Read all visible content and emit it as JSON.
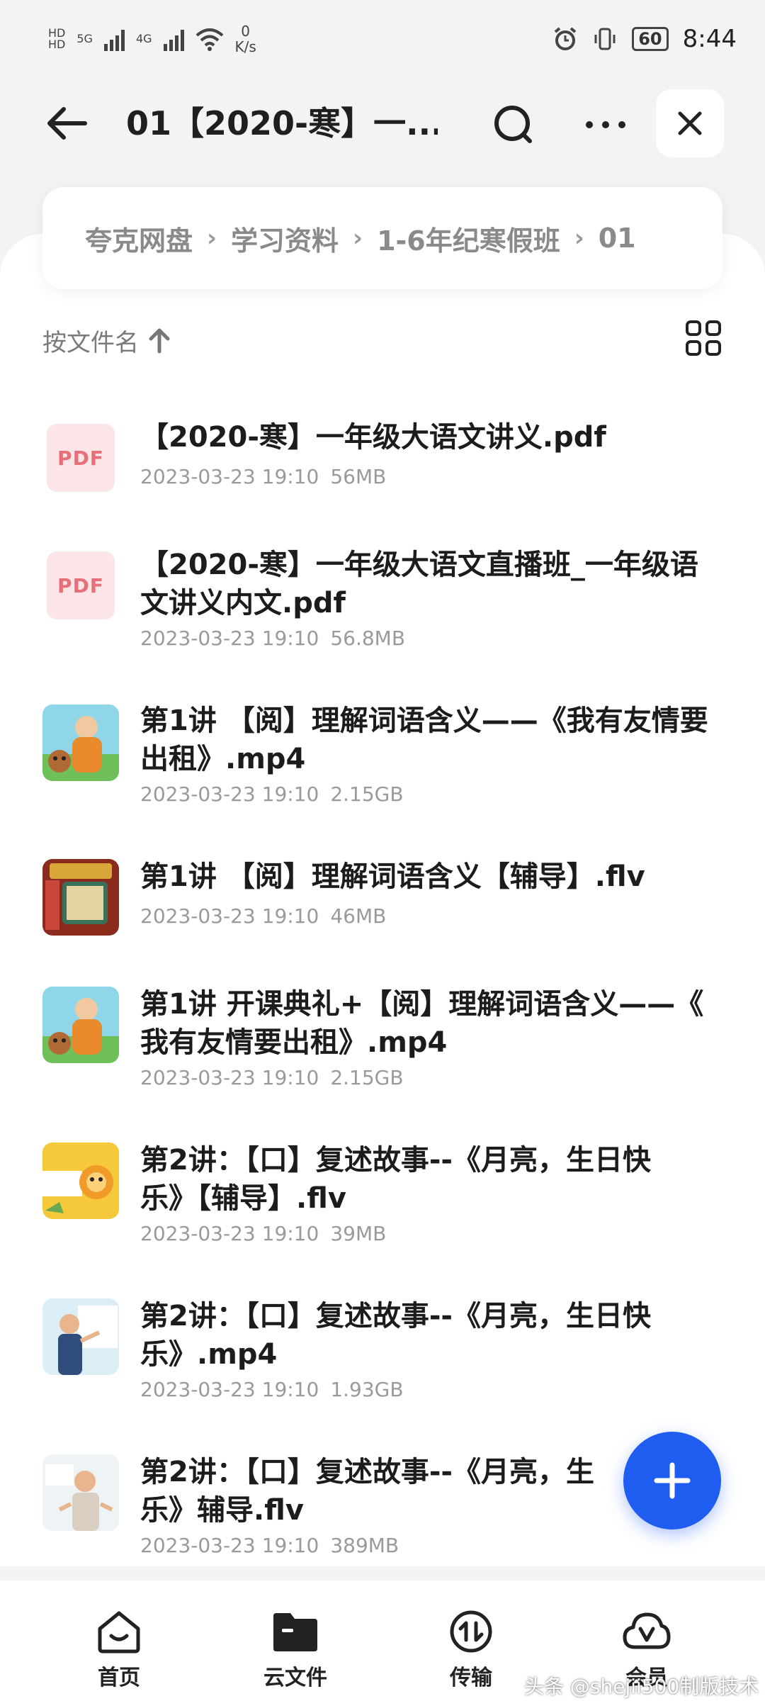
{
  "status_bar": {
    "net_speed_value": "0",
    "net_speed_unit": "K/s",
    "battery": "60",
    "time": "8:44",
    "sim1": "5G",
    "sim2": "4G"
  },
  "header": {
    "title": "01【2020-寒】一...",
    "icons": [
      "back-arrow-icon",
      "search-icon",
      "more-icon",
      "close-icon"
    ]
  },
  "breadcrumb": [
    "夸克网盘",
    "学习资料",
    "1-6年纪寒假班",
    "01"
  ],
  "sort": {
    "label": "按文件名"
  },
  "files": [
    {
      "name_line1": "【2020-寒】一年级大语文讲义.pdf",
      "name_line2": "",
      "date": "2023-03-23 19:10",
      "size": "56MB",
      "thumb": "pdf",
      "thumb_label": "PDF"
    },
    {
      "name_line1": "【2020-寒】一年级大语文直播班_一年级语",
      "name_line2": "文讲义内文.pdf",
      "date": "2023-03-23 19:10",
      "size": "56.8MB",
      "thumb": "pdf",
      "thumb_label": "PDF"
    },
    {
      "name_line1": "第1讲 【阅】理解词语含义——《我有友情要",
      "name_line2": "出租》.mp4",
      "date": "2023-03-23 19:10",
      "size": "2.15GB",
      "thumb": "video-cartoon"
    },
    {
      "name_line1": "第1讲 【阅】理解词语含义【辅导】.flv",
      "name_line2": "",
      "date": "2023-03-23 19:10",
      "size": "46MB",
      "thumb": "video-board"
    },
    {
      "name_line1": "第1讲 开课典礼+【阅】理解词语含义——《",
      "name_line2": "我有友情要出租》.mp4",
      "date": "2023-03-23 19:10",
      "size": "2.15GB",
      "thumb": "video-cartoon"
    },
    {
      "name_line1": "第2讲：【口】复述故事--《月亮，生日快",
      "name_line2": "乐》【辅导】.flv",
      "date": "2023-03-23 19:10",
      "size": "39MB",
      "thumb": "video-yellow"
    },
    {
      "name_line1": "第2讲：【口】复述故事--《月亮，生日快",
      "name_line2": "乐》.mp4",
      "date": "2023-03-23 19:10",
      "size": "1.93GB",
      "thumb": "video-teacher"
    },
    {
      "name_line1": "第2讲：【口】复述故事--《月亮，生",
      "name_line2": "乐》辅导.flv",
      "date": "2023-03-23 19:10",
      "size": "389MB",
      "thumb": "video-teacher2"
    }
  ],
  "bottom_nav": [
    {
      "label": "首页",
      "icon": "home-icon"
    },
    {
      "label": "云文件",
      "icon": "folder-icon"
    },
    {
      "label": "传输",
      "icon": "transfer-icon"
    },
    {
      "label": "会员",
      "icon": "vip-cloud-icon"
    }
  ],
  "watermark": "头条 @shejii500制版技术",
  "colors": {
    "accent": "#1f5cf0",
    "pdf_bg": "#fbe5e6",
    "pdf_text": "#e86f77"
  }
}
